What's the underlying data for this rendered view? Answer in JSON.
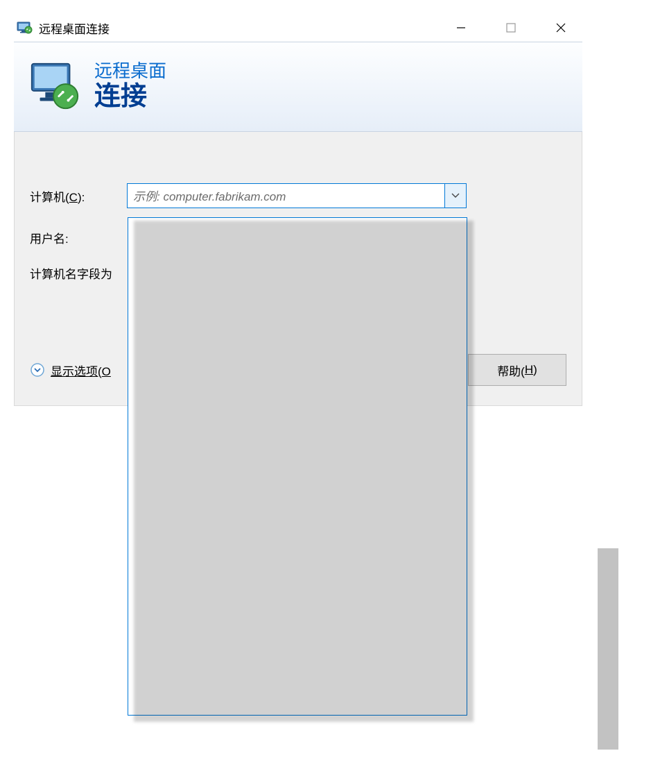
{
  "titlebar": {
    "title": "远程桌面连接"
  },
  "header": {
    "line1": "远程桌面",
    "line2": "连接"
  },
  "form": {
    "computer_label_pre": "计算机(",
    "computer_label_key": "C",
    "computer_label_post": "):",
    "computer_placeholder": "示例: computer.fabrikam.com",
    "user_label": "用户名:",
    "hint_pre": "计算机名字段为"
  },
  "actions": {
    "showopts_pre": "显示选项(",
    "showopts_key": "O",
    "help_pre": "帮助(",
    "help_key": "H",
    "help_post": ")"
  }
}
